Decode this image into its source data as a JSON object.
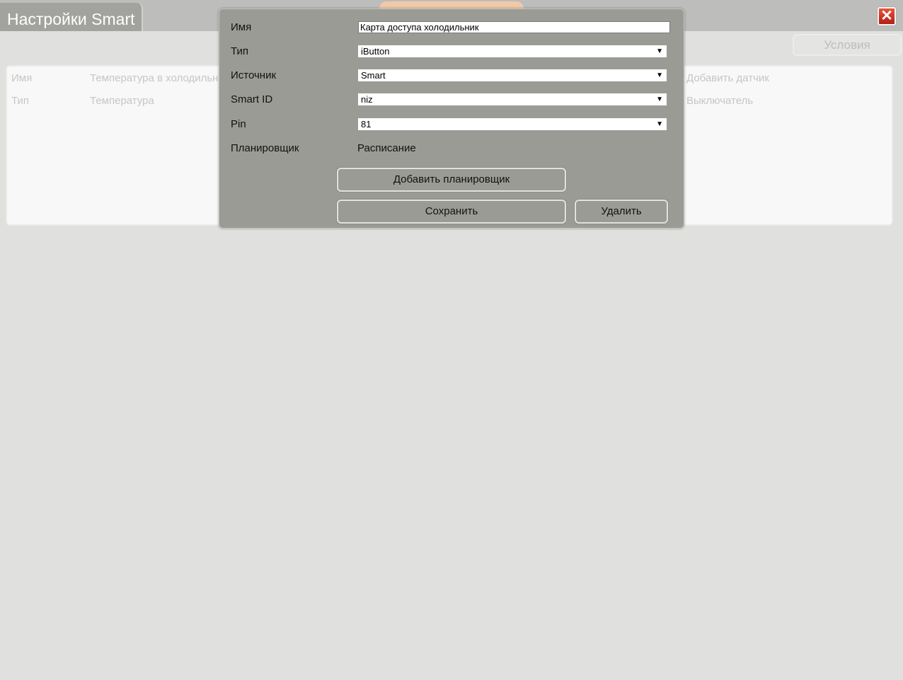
{
  "header": {
    "title": "Настройки Smart",
    "close_icon": "close-icon",
    "conditions_label": "Условия"
  },
  "background": {
    "row1": {
      "label": "Имя",
      "value": "Температура в холодильн",
      "action": "Добавить датчик"
    },
    "row2": {
      "label": "Тип",
      "value": "Температура",
      "action": "Выключатель"
    }
  },
  "dialog": {
    "name_label": "Имя",
    "name_value": "Карта доступа холодильник",
    "type_label": "Тип",
    "type_value": "iButton",
    "source_label": "Источник",
    "source_value": "Smart",
    "smartid_label": "Smart ID",
    "smartid_value": "niz",
    "pin_label": "Pin",
    "pin_value": "81",
    "scheduler_label": "Планировщик",
    "scheduler_value": "Расписание",
    "add_scheduler_label": "Добавить планировщик",
    "save_label": "Сохранить",
    "delete_label": "Удалить",
    "dropdown_icon": "▼"
  },
  "colors": {
    "close_button": "#d23a24",
    "dialog_background": "#9b9b96",
    "page_background": "#e0e0de"
  }
}
